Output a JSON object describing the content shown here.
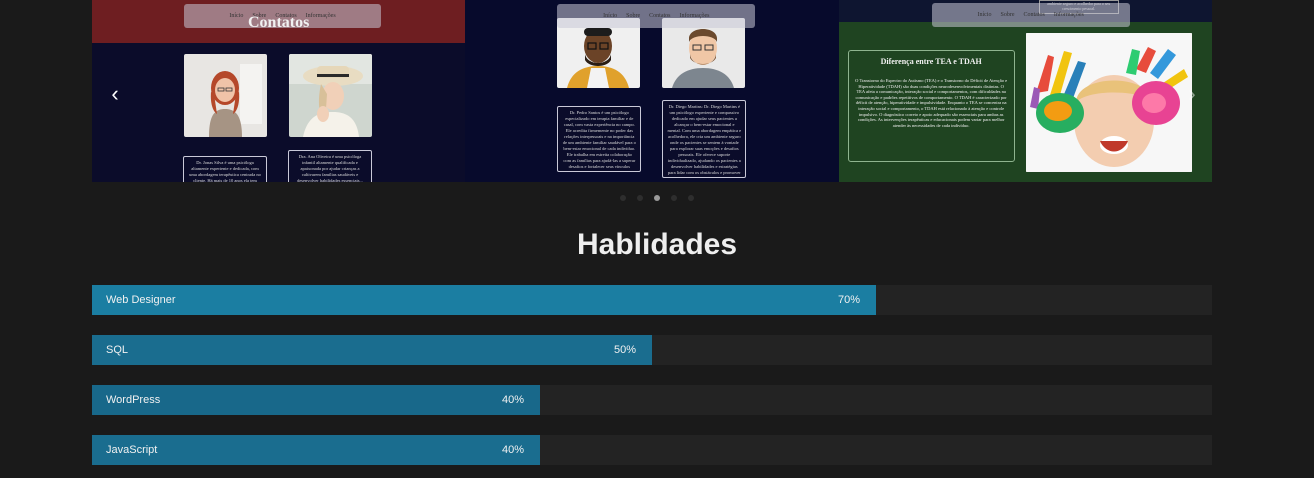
{
  "carousel": {
    "slides": [
      {
        "banner_title": "Contatos",
        "nav": [
          "Início",
          "Sobre",
          "Contatos",
          "Informações"
        ],
        "cards": [
          "Dr. Jonas Silva é uma psicóloga altamente experiente e dedicada, com uma abordagem terapêutica centrada no cliente. Há mais de 10 anos ela tem ajudado pacientes a superar...",
          "Dra. Ana Oliveira é uma psicóloga infantil altamente qualificada e apaixonada por ajudar crianças a cultivarem famílias saudáveis e desenvolver habilidades essenciais..."
        ]
      },
      {
        "nav": [
          "Início",
          "Sobre",
          "Contatos",
          "Informações"
        ],
        "cards": [
          "Dr. Pedro Santos é um psicólogo especializado em terapia familiar e de casal, com vasta experiência no campo. Ele acredita firmemente no poder das relações interpessoais e na importância de um ambiente familiar saudável para o bem-estar emocional de cada indivíduo. Ele trabalha em estreita colaboração com as famílias para ajudá-las a superar desafios e fortalecer seus vínculos emocionais.",
          "Dr. Diego Martins: Dr. Diego Martins é um psicólogo experiente e compassivo dedicado em ajudar seus pacientes a alcançar o bem-estar emocional e mental. Com uma abordagem empática e acolhedora, ele cria um ambiente seguro onde os pacientes se sentem à vontade para explorar suas emoções e desafios pessoais. Ele oferece suporte individualizado, ajudando os pacientes a desenvolver habilidades e estratégias para lidar com os obstáculos e promover seu crescimento pessoal."
        ]
      },
      {
        "nav": [
          "Início",
          "Sobre",
          "Contatos",
          "Informações"
        ],
        "top_box": "ambiente seguro e acolhedor para o seu crescimento pessoal.",
        "info_title": "Diferença entre TEA e TDAH",
        "info_text": "O Transtorno do Espectro do Autismo (TEA) e o Transtorno do Déficit de Atenção e Hiperatividade (TDAH) são duas condições neurodesenvolvimentais distintas. O TEA afeta a comunicação, interação social e comportamentos, com dificuldades na comunicação e padrões repetitivos de comportamento. O TDAH é caracterizado por déficit de atenção, hiperatividade e impulsividade. Enquanto o TEA se concentra na interação social e comportamento, o TDAH está relacionado à atenção e controle impulsivo. O diagnóstico correto e apoio adequado são essenciais para ambas as condições. As intervenções terapêuticas e educacionais podem variar para melhor atender às necessidades de cada indivíduo."
      }
    ],
    "prev_icon": "‹",
    "next_icon": "›",
    "dots_count": 5,
    "active_dot": 2
  },
  "skills": {
    "title": "Hablidades",
    "items": [
      {
        "name": "Web Designer",
        "percent_label": "70%",
        "percent": 70,
        "color": "#1b7ea2"
      },
      {
        "name": "SQL",
        "percent_label": "50%",
        "percent": 50,
        "color": "#1a6d8f"
      },
      {
        "name": "WordPress",
        "percent_label": "40%",
        "percent": 40,
        "color": "#18688a"
      },
      {
        "name": "JavaScript",
        "percent_label": "40%",
        "percent": 40,
        "color": "#1a6d8f"
      }
    ]
  }
}
